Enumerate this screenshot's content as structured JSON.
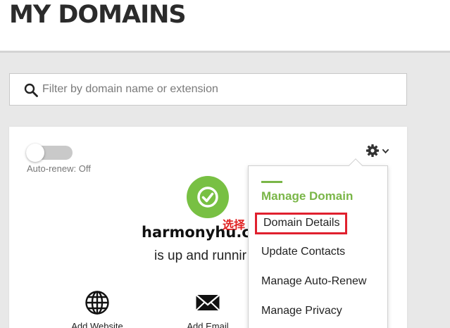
{
  "header": {
    "title": "MY DOMAINS"
  },
  "search": {
    "placeholder": "Filter by domain name or extension",
    "value": ""
  },
  "card": {
    "auto_renew": {
      "label": "Auto-renew: Off",
      "enabled": false
    },
    "domain": "harmonyhu.c",
    "status": "is up and runnir",
    "status_color": "#78c043",
    "actions": [
      {
        "label": "Add Website",
        "icon": "globe-icon"
      },
      {
        "label": "Add Email",
        "icon": "envelope-icon"
      }
    ]
  },
  "annotation": {
    "text": "选择",
    "color": "#e02020"
  },
  "dropdown": {
    "title": "Manage Domain",
    "accent_color": "#7ab648",
    "items": [
      {
        "label": "Domain Details",
        "highlighted": true
      },
      {
        "label": "Update Contacts"
      },
      {
        "label": "Manage Auto-Renew"
      },
      {
        "label": "Manage Privacy"
      }
    ]
  }
}
